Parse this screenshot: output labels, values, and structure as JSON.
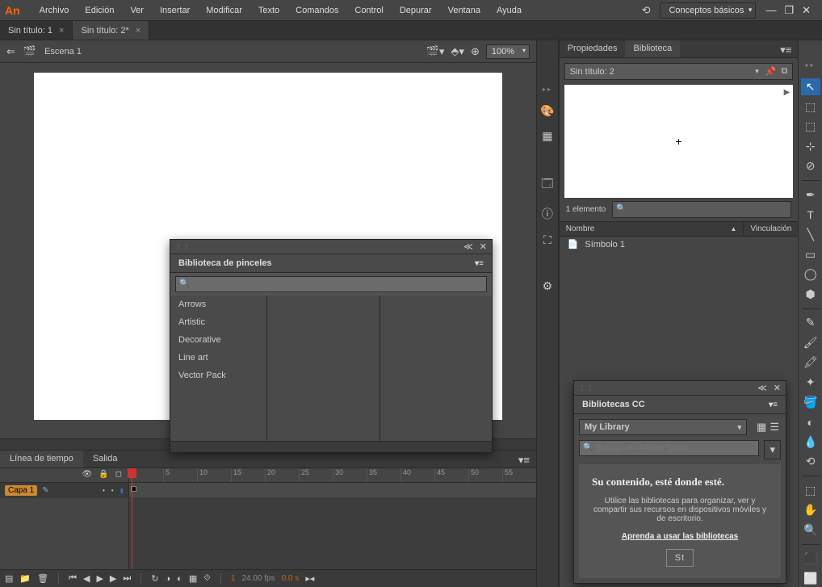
{
  "app": {
    "logo": "An"
  },
  "menubar": {
    "items": [
      "Archivo",
      "Edición",
      "Ver",
      "Insertar",
      "Modificar",
      "Texto",
      "Comandos",
      "Control",
      "Depurar",
      "Ventana",
      "Ayuda"
    ],
    "workspace": "Conceptos básicos"
  },
  "tabs": [
    {
      "label": "Sin título: 1",
      "active": false
    },
    {
      "label": "Sin título: 2*",
      "active": true
    }
  ],
  "scene": {
    "back_icon": "⇐",
    "clapper": "🎬",
    "name": "Escena 1",
    "zoom": "100%"
  },
  "brush_panel": {
    "title": "Biblioteca de pinceles",
    "search_placeholder": "",
    "categories": [
      "Arrows",
      "Artistic",
      "Decorative",
      "Line art",
      "Vector Pack"
    ]
  },
  "timeline": {
    "tabs": [
      {
        "label": "Línea de tiempo",
        "active": true
      },
      {
        "label": "Salida",
        "active": false
      }
    ],
    "layer": {
      "name": "Capa 1"
    },
    "ruler": [
      "1",
      "5",
      "10",
      "15",
      "20",
      "25",
      "30",
      "35",
      "40",
      "45",
      "50",
      "55"
    ],
    "status": {
      "frame": "1",
      "fps": "24.00 fps",
      "time": "0.0 s"
    }
  },
  "right": {
    "tabs": [
      {
        "label": "Propiedades",
        "active": false
      },
      {
        "label": "Biblioteca",
        "active": true
      }
    ],
    "doc": "Sin título: 2",
    "count": "1 elemento",
    "columns": {
      "name": "Nombre",
      "link": "Vinculación"
    },
    "items": [
      {
        "name": "Símbolo 1"
      }
    ]
  },
  "cc": {
    "title": "Bibliotecas CC",
    "library": "My Library",
    "search_placeholder": "Buscar en Adobe Stock",
    "heading": "Su contenido, esté donde esté.",
    "text": "Utilice las bibliotecas para organizar, ver y compartir sus recursos en dispositivos móviles y de escritorio.",
    "link": "Aprenda a usar las bibliotecas",
    "stock": "St"
  },
  "tools": [
    "⬚",
    "↖",
    "⬚",
    "⊹",
    "⊘",
    "✦",
    "✒",
    "T",
    "╲",
    "▭",
    "◯",
    "⬢",
    "🖌",
    "⟲",
    "🖍",
    "✎",
    "🪣",
    "◐",
    "💧",
    "⬛",
    "⬜",
    "⬚",
    "✋",
    "🔍"
  ]
}
